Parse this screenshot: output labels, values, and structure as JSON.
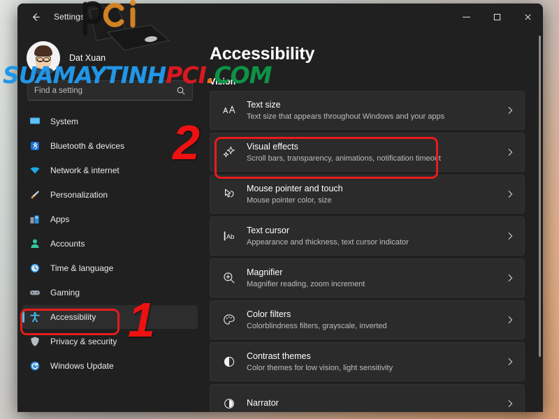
{
  "window": {
    "titlebar": {
      "back_label": "back-arrow",
      "title": "Settings",
      "minimize": "minimize",
      "maximize": "maximize",
      "close": "close"
    }
  },
  "sidebar": {
    "profile": {
      "name": "Dat Xuan"
    },
    "search": {
      "value": "",
      "placeholder": "Find a setting",
      "icon": "search-icon"
    },
    "items": [
      {
        "label": "System",
        "icon": "monitor-icon",
        "selected": false
      },
      {
        "label": "Bluetooth & devices",
        "icon": "bluetooth-icon",
        "selected": false
      },
      {
        "label": "Network & internet",
        "icon": "wifi-icon",
        "selected": false
      },
      {
        "label": "Personalization",
        "icon": "brush-icon",
        "selected": false
      },
      {
        "label": "Apps",
        "icon": "apps-icon",
        "selected": false
      },
      {
        "label": "Accounts",
        "icon": "person-icon",
        "selected": false
      },
      {
        "label": "Time & language",
        "icon": "clock-icon",
        "selected": false
      },
      {
        "label": "Gaming",
        "icon": "gamepad-icon",
        "selected": false
      },
      {
        "label": "Accessibility",
        "icon": "accessibility-icon",
        "selected": true
      },
      {
        "label": "Privacy & security",
        "icon": "shield-icon",
        "selected": false
      },
      {
        "label": "Windows Update",
        "icon": "update-icon",
        "selected": false
      }
    ]
  },
  "main": {
    "page_title": "Accessibility",
    "section_heading": "Vision",
    "rows": [
      {
        "title": "Text size",
        "subtitle": "Text size that appears throughout Windows and your apps",
        "icon": "text-size-icon",
        "highlighted": false
      },
      {
        "title": "Visual effects",
        "subtitle": "Scroll bars, transparency, animations, notification timeout",
        "icon": "sparkle-icon",
        "highlighted": true
      },
      {
        "title": "Mouse pointer and touch",
        "subtitle": "Mouse pointer color, size",
        "icon": "mouse-pointer-icon",
        "highlighted": false
      },
      {
        "title": "Text cursor",
        "subtitle": "Appearance and thickness, text cursor indicator",
        "icon": "text-cursor-icon",
        "highlighted": false
      },
      {
        "title": "Magnifier",
        "subtitle": "Magnifier reading, zoom increment",
        "icon": "magnifier-icon",
        "highlighted": false
      },
      {
        "title": "Color filters",
        "subtitle": "Colorblindness filters, grayscale, inverted",
        "icon": "palette-icon",
        "highlighted": false
      },
      {
        "title": "Contrast themes",
        "subtitle": "Color themes for low vision, light sensitivity",
        "icon": "contrast-icon",
        "highlighted": false
      },
      {
        "title": "Narrator",
        "subtitle": "",
        "icon": "narrator-icon",
        "highlighted": false
      }
    ]
  },
  "annotations": {
    "step_one": "1",
    "step_two": "2",
    "box_color": "#e81c1c",
    "number_color": "#ee1111"
  },
  "watermark": {
    "logo": "pci",
    "text_parts": [
      {
        "text": "SUAMAYTINH",
        "color": "#2196e8"
      },
      {
        "text": "PCI",
        "color": "#d81920"
      },
      {
        "text": ".",
        "color": "#e8741c"
      },
      {
        "text": "COM",
        "color": "#0d9346"
      }
    ]
  },
  "colors": {
    "window_bg": "#202020",
    "card_bg": "#2b2b2b",
    "accent": "#4cc2ff",
    "selected_bg": "#2d2d2d"
  }
}
